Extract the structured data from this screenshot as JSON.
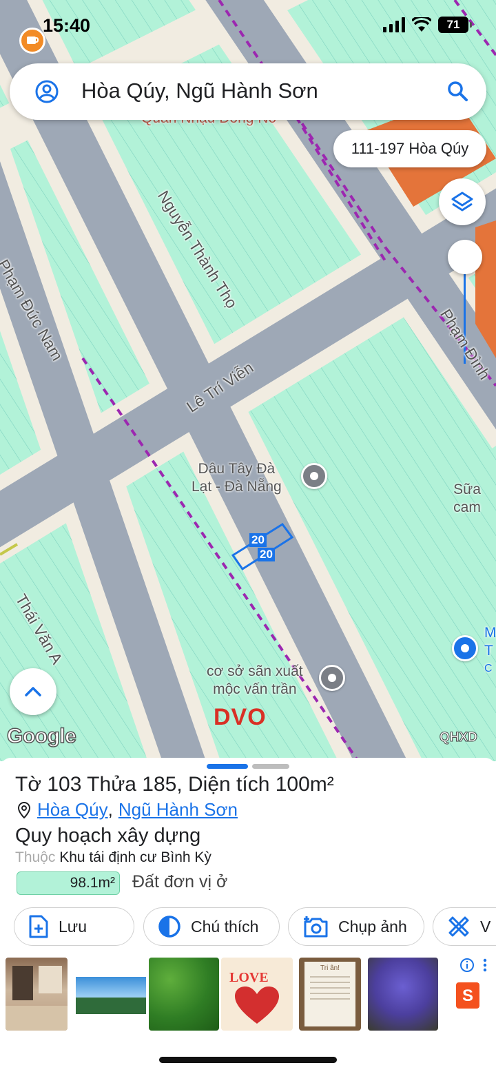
{
  "status_bar": {
    "time": "15:40",
    "battery": "71"
  },
  "search": {
    "query": "Hòa Qúy, Ngũ Hành Sơn"
  },
  "map": {
    "address_chip": "111-197 Hòa Qúy",
    "streets": {
      "nguyen_thanh_tho": "Nguyễn Thành Thọ",
      "pham_duc_nam": "Phạm Đức Nam",
      "le_tri_vien": "Lê Trí Viễn",
      "pham_dinh": "Phạm Đình",
      "thai_van_a": "Thái Văn A"
    },
    "pois": {
      "strawberry_line1": "Dâu Tây Đà",
      "strawberry_line2": "Lạt - Đà Nẵng",
      "ceiling_line1": "cơ sở sãn xuất",
      "ceiling_line2": "mộc vấn trần",
      "milk": "Sữa cam",
      "top_partial": "Quán Nhậu Đồng Nơ",
      "right_partial_1": "M",
      "right_partial_2": "T",
      "right_partial_3": "C"
    },
    "plot_labels": [
      "20",
      "20"
    ],
    "watermark": "DVO",
    "google_logo": "Google",
    "layer_code": "QHXD"
  },
  "sheet": {
    "title": "Tờ 103 Thửa 185, Diện tích 100m²",
    "location": {
      "ward": "Hòa Qúy",
      "separator": ",",
      "district": "Ngũ Hành Sơn"
    },
    "plan_title": "Quy hoạch xây dựng",
    "belongs_prefix": "Thuộc",
    "belongs_name": "Khu tái định cư Bình Kỳ",
    "area_value": "98.1m²",
    "area_type": "Đất đơn vị ở",
    "actions": {
      "save": "Lưu",
      "legend": "Chú thích",
      "photo": "Chụp ảnh",
      "measure": "V"
    },
    "ad_thumb_love": "LOVE",
    "ad_thumb_card": "Tri ân!"
  },
  "colors": {
    "accent": "#1a73e8",
    "land": "#b2f2d8",
    "road": "#9ea8b6",
    "sidewalk": "#f1ece1",
    "boundary": "#9c27b0",
    "commercial": "#e4743a",
    "watermark": "#d93025"
  }
}
